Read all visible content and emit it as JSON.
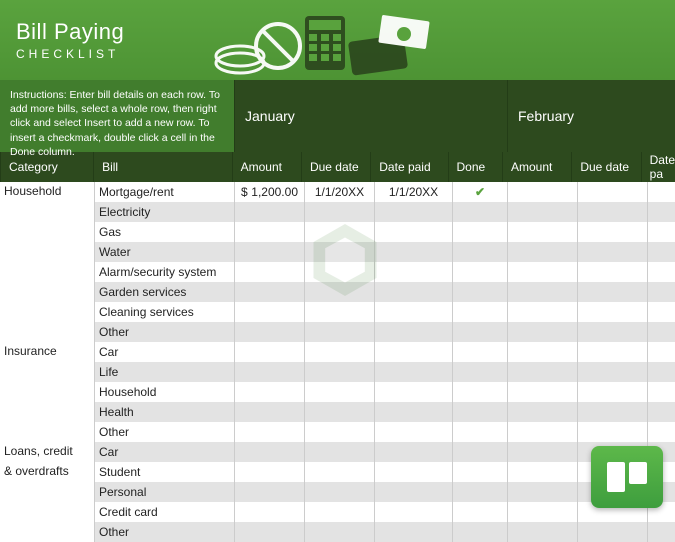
{
  "header": {
    "title": "Bill Paying",
    "subtitle": "CHECKLIST"
  },
  "instructions": "Instructions: Enter bill details on each row. To add more bills, select a whole row, then right click and select Insert to add a new row. To insert a checkmark, double click a cell in the Done column.",
  "months": [
    "January",
    "February"
  ],
  "columns": {
    "category": "Category",
    "bill": "Bill",
    "amount": "Amount",
    "due": "Due date",
    "paid": "Date paid",
    "done": "Done",
    "amount2": "Amount",
    "due2": "Due date",
    "paid2": "Date pa"
  },
  "rows": [
    {
      "category": "Household",
      "bill": "Mortgage/rent",
      "amount_prefix": "$",
      "amount": "1,200.00",
      "due": "1/1/20XX",
      "paid": "1/1/20XX",
      "done": "✔"
    },
    {
      "category": "",
      "bill": "Electricity"
    },
    {
      "category": "",
      "bill": "Gas"
    },
    {
      "category": "",
      "bill": "Water"
    },
    {
      "category": "",
      "bill": "Alarm/security system"
    },
    {
      "category": "",
      "bill": "Garden services"
    },
    {
      "category": "",
      "bill": "Cleaning services"
    },
    {
      "category": "",
      "bill": "Other"
    },
    {
      "category": "Insurance",
      "bill": "Car"
    },
    {
      "category": "",
      "bill": "Life"
    },
    {
      "category": "",
      "bill": "Household"
    },
    {
      "category": "",
      "bill": "Health"
    },
    {
      "category": "",
      "bill": "Other"
    },
    {
      "category": "Loans, credit",
      "bill": "Car"
    },
    {
      "category": "& overdrafts",
      "bill": "Student"
    },
    {
      "category": "",
      "bill": "Personal"
    },
    {
      "category": "",
      "bill": "Credit card"
    },
    {
      "category": "",
      "bill": "Other"
    }
  ]
}
